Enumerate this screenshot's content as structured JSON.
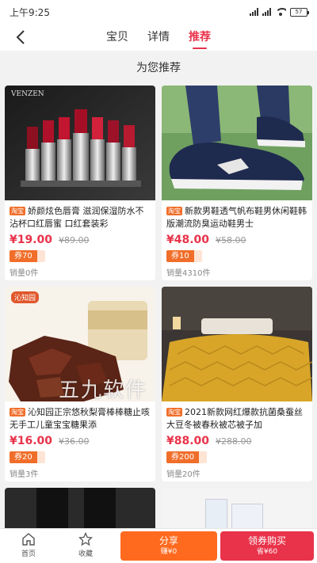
{
  "status_bar": {
    "time": "上午9:25",
    "battery": "57"
  },
  "nav": {
    "tabs": [
      "宝贝",
      "详情",
      "推荐"
    ],
    "active_tab": "推荐"
  },
  "section_title": "为您推荐",
  "products": [
    {
      "tag": "淘宝",
      "title": "娇颜炫色唇膏 滋润保湿防水不沾杯口红唇蜜 口红套装彩",
      "price": "¥19.00",
      "original_price": "¥89.00",
      "coupon": "券70",
      "sales": "销量0件",
      "image": "lipstick-set",
      "brand": "VENZEN"
    },
    {
      "tag": "淘宝",
      "title": "新款男鞋透气帆布鞋男休闲鞋韩版潮流防臭运动鞋男士",
      "price": "¥48.00",
      "original_price": "¥58.00",
      "coupon": "券10",
      "sales": "销量4310件",
      "image": "navy-sneaker"
    },
    {
      "tag": "淘宝",
      "title": "沁知园正宗悠秋梨膏棒棒糖止咳无手工儿童宝宝糖果添",
      "price": "¥16.00",
      "original_price": "¥36.00",
      "coupon": "券20",
      "sales": "销量3件",
      "image": "pear-candy",
      "brand": "沁知园"
    },
    {
      "tag": "淘宝",
      "title": "2021新款网红爆款抗菌桑蚕丝大豆冬被春秋被芯被子加",
      "price": "¥88.00",
      "original_price": "¥288.00",
      "coupon": "券200",
      "sales": "销量20件",
      "image": "yellow-quilt"
    }
  ],
  "partial_products": [
    {
      "image": "black-pants"
    },
    {
      "image": "white-bag"
    }
  ],
  "watermark": "五九软件",
  "bottom_bar": {
    "home_label": "首页",
    "favorite_label": "收藏",
    "share_label": "分享",
    "share_sub": "赚¥0",
    "buy_label": "领券购买",
    "buy_sub": "省¥60"
  },
  "colors": {
    "accent": "#e8334a",
    "orange": "#ff6a1f",
    "tag": "#f06e2a"
  }
}
